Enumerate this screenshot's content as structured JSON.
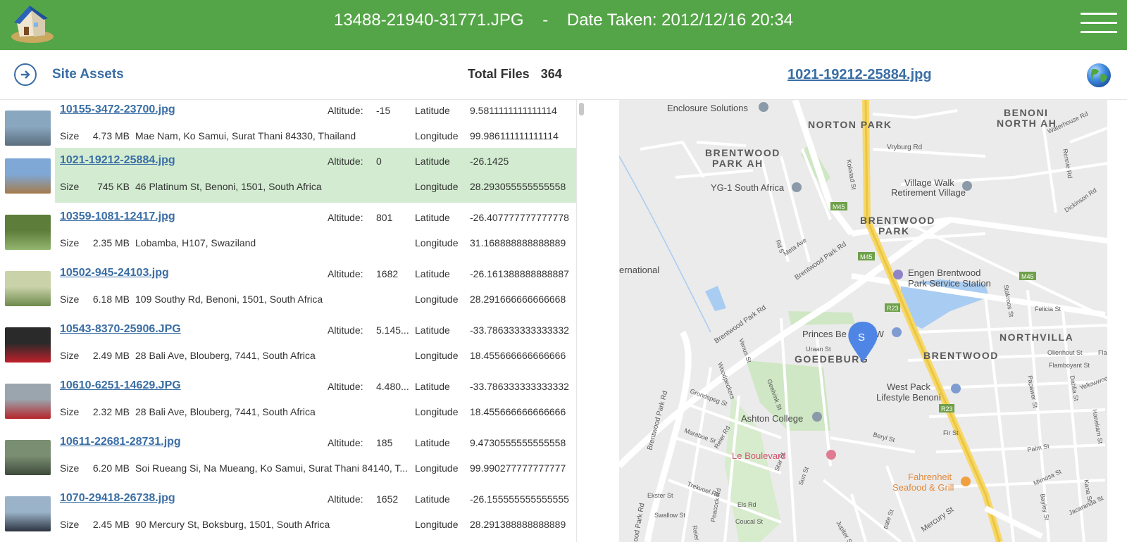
{
  "header": {
    "filename": "13488-21940-31771.JPG",
    "separator": "-",
    "date_taken": "Date Taken: 2012/12/16 20:34",
    "logo_icon": "house-logo-icon",
    "menu_icon": "hamburger-menu-icon"
  },
  "toolbar": {
    "site_assets_label": "Site Assets",
    "total_files_label": "Total Files",
    "total_files_value": "364",
    "selected_file": "1021-19212-25884.jpg",
    "globe_icon": "globe-icon"
  },
  "list_labels": {
    "altitude": "Altitude:",
    "latitude": "Latitude",
    "longitude": "Longitude",
    "size": "Size"
  },
  "files": [
    {
      "name": "10155-3472-23700.jpg",
      "altitude": "-15",
      "latitude": "9.5811111111111114",
      "size": "4.73 MB",
      "address": "Mae Nam, Ko Samui, Surat Thani 84330, Thailand",
      "longitude": "99.986111111111114",
      "selected": false
    },
    {
      "name": "1021-19212-25884.jpg",
      "altitude": "0",
      "latitude": "-26.1425",
      "size": "745 KB",
      "address": "46 Platinum St, Benoni, 1501, South Africa",
      "longitude": "28.293055555555558",
      "selected": true
    },
    {
      "name": "10359-1081-12417.jpg",
      "altitude": "801",
      "latitude": "-26.407777777777778",
      "size": "2.35 MB",
      "address": "Lobamba, H107, Swaziland",
      "longitude": "31.168888888888889",
      "selected": false
    },
    {
      "name": "10502-945-24103.jpg",
      "altitude": "1682",
      "latitude": "-26.161388888888887",
      "size": "6.18 MB",
      "address": "109 Southy Rd, Benoni, 1501, South Africa",
      "longitude": "28.291666666666668",
      "selected": false
    },
    {
      "name": "10543-8370-25906.JPG",
      "altitude": "5.145...",
      "latitude": "-33.786333333333332",
      "size": "2.49 MB",
      "address": "28 Bali Ave, Blouberg, 7441, South Africa",
      "longitude": "18.455666666666666",
      "selected": false
    },
    {
      "name": "10610-6251-14629.JPG",
      "altitude": "4.480...",
      "latitude": "-33.786333333333332",
      "size": "2.32 MB",
      "address": "28 Bali Ave, Blouberg, 7441, South Africa",
      "longitude": "18.455666666666666",
      "selected": false
    },
    {
      "name": "10611-22681-28731.jpg",
      "altitude": "185",
      "latitude": "9.4730555555555558",
      "size": "6.20 MB",
      "address": "Soi Rueang Si, Na Mueang, Ko Samui, Surat Thani 84140, T...",
      "longitude": "99.990277777777777",
      "selected": false
    },
    {
      "name": "1070-29418-26738.jpg",
      "altitude": "1652",
      "latitude": "-26.155555555555555",
      "size": "2.45 MB",
      "address": "90 Mercury St, Boksburg, 1501, South Africa",
      "longitude": "28.291388888888889",
      "selected": false
    }
  ],
  "map": {
    "marker_letter": "S",
    "labels": {
      "enclosure": "Enclosure Solutions",
      "norton_park": "NORTON PARK",
      "benoni_north_1": "BENONI",
      "benoni_north_2": "NORTH AH",
      "waterhouse": "Waterhouse Rd",
      "brentwood_ah_1": "BRENTWOOD",
      "brentwood_ah_2": "PARK AH",
      "vryburg": "Vryburg Rd",
      "rennie": "Rennie Rd",
      "kokstad": "Kokstad St",
      "yg1": "YG-1 South Africa",
      "village_walk_1": "Village Walk",
      "village_walk_2": "Retirement Village",
      "dickinson": "Dickinson Rd",
      "m45_a": "M45",
      "m45_b": "M45",
      "m45_c": "M45",
      "brentwood_park_1": "BRENTWOOD",
      "brentwood_park_2": "PARK",
      "rd5": "Rd 5",
      "meta_ave": "Meta Ave",
      "brentwood_park_rd_1": "Brentwood Park Rd",
      "international": "ernational",
      "engen_1": "Engen Brentwood",
      "engen_2": "Park Service Station",
      "r23_a": "R23",
      "r23_b": "R23",
      "stakroos": "Stakroos St",
      "felicia": "Felicia St",
      "brentwood_park_rd_2": "Brentwood Park Rd",
      "venus": "Venus St",
      "princes": "Princes Be",
      "vw": "VW",
      "uraan": "Uraan St",
      "northvilla": "NORTHVILLA",
      "goedeburg": "GOEDEBURG",
      "brentwood": "BRENTWOOD",
      "olienhout": "Olienhout St",
      "flamboyant": "Flamboyant St",
      "fla": "Fla",
      "yellowwood": "Yellowwood",
      "westpack_1": "West Pack",
      "westpack_2": "Lifestyle Benoni",
      "woodpeckers": "Woodpeckers",
      "geelvink": "Geelvink St",
      "grondspeg": "Grondspeg St",
      "papawer": "Papawer St",
      "dahlia": "Dahlia St",
      "ashton": "Ashton College",
      "brentwood_park_rd_3": "Brentwood Park Rd",
      "maraboe": "Maraboe St",
      "reier": "Reier Rd",
      "beryl": "Beryl St",
      "hanekam": "Hanekam St",
      "le_boulevard": "Le Boulevard",
      "fir": "Fir St",
      "palm": "Palm St",
      "trekvoel": "Trekvoel Rd",
      "star": "Star St",
      "sun": "Sun St",
      "mimosa": "Mimosa St",
      "fahrenheit_1": "Fahrenheit",
      "fahrenheit_2": "Seafood & Grill",
      "ekster": "Ekster St",
      "peacock": "Peacock Rd",
      "els": "Els Rd",
      "jacaranda": "Jacaranda St",
      "swallow": "Swallow St",
      "coucal": "Coucal St",
      "mercury": "Mercury St",
      "bayley": "Bayley St",
      "good_park": "ood Park Rd",
      "reier_rd": "Reier Rd",
      "jupiter": "Jupiter St",
      "pate": "pate St",
      "kana": "Kana St"
    }
  }
}
